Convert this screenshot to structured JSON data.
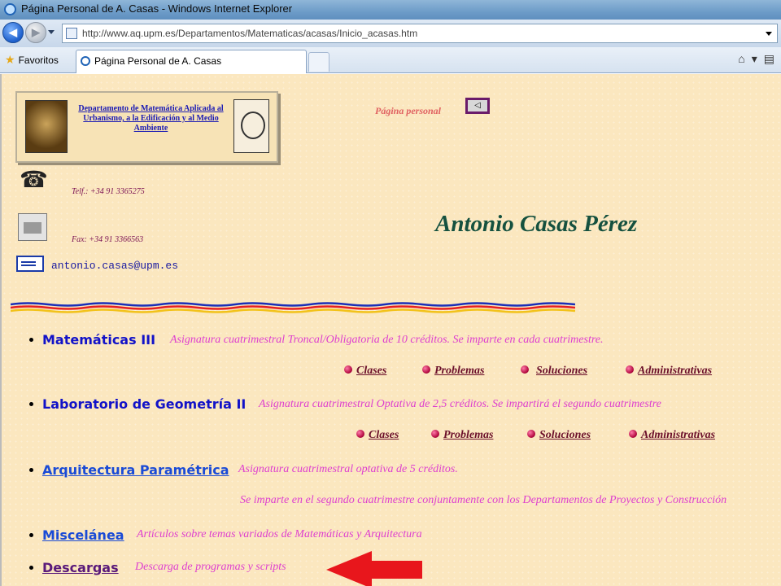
{
  "window": {
    "title": "Página Personal de A. Casas - Windows Internet Explorer"
  },
  "address": {
    "url": "http://www.aq.upm.es/Departamentos/Matematicas/acasas/Inicio_acasas.htm"
  },
  "tabs": {
    "favorites_label": "Favoritos",
    "active_tab": "Página Personal de A. Casas"
  },
  "header": {
    "department": "Departamento de Matemática Aplicada al Urbanismo, a la Edificación y al Medio Ambiente",
    "personal_label": "Página personal",
    "back_symbol": "◁"
  },
  "contact": {
    "telephone": "Telf.: +34 91 3365275",
    "fax": "Fax: +34 91 3366563",
    "email": "antonio.casas@upm.es"
  },
  "owner_name": "Antonio Casas Pérez",
  "courses": [
    {
      "title": "Matemáticas III",
      "description": "Asignatura cuatrimestral Troncal/Obligatoria de 10 créditos. Se imparte en cada cuatrimestre.",
      "links": [
        "Clases",
        "Problemas",
        "Soluciones",
        "Administrativas"
      ]
    },
    {
      "title": "Laboratorio de Geometría II",
      "description": "Asignatura cuatrimestral Optativa de 2,5 créditos. Se impartirá el segundo cuatrimestre",
      "links": [
        "Clases",
        "Problemas",
        "Soluciones",
        "Administrativas"
      ]
    },
    {
      "title": "Arquitectura Paramétrica",
      "description": "Asignatura cuatrimestral optativa de 5 créditos.",
      "description_2": "Se imparte en el segundo cuatrimestre conjuntamente con los Departamentos de Proyectos y Construcción"
    },
    {
      "title": "Miscelánea",
      "description": "Artículos sobre temas variados de Matemáticas y Arquitectura"
    },
    {
      "title": "Descargas",
      "description": "Descarga de programas y scripts"
    }
  ],
  "colors": {
    "page_bg": "#fbe7bf",
    "link_blue": "#1212c8",
    "desc_pink": "#de3fcf",
    "sublink": "#6b0f2a",
    "name_green": "#15513f",
    "arrow_red": "#e8161c"
  }
}
